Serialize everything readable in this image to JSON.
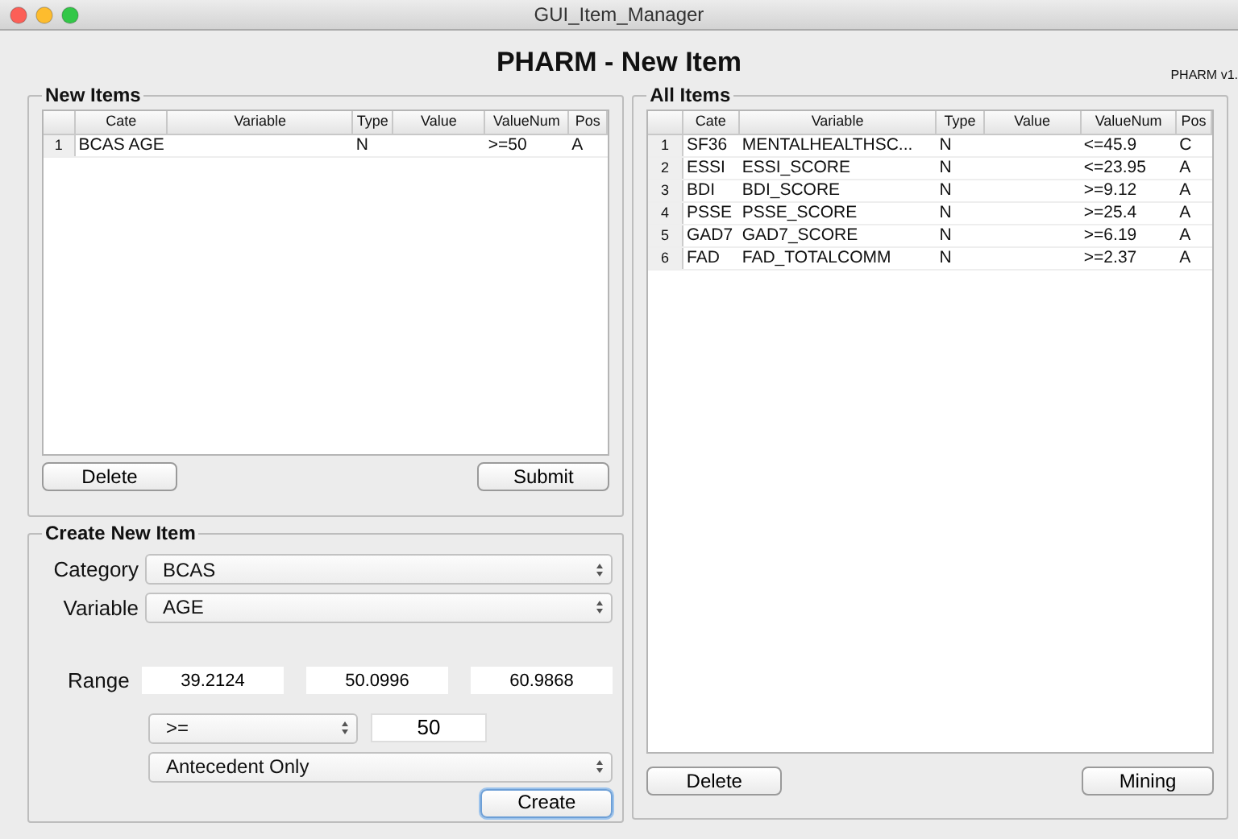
{
  "window": {
    "title": "GUI_Item_Manager"
  },
  "header": {
    "title": "PHARM - New Item",
    "version": "PHARM v1."
  },
  "new_items": {
    "title": "New Items",
    "table": {
      "columns": [
        "Cate",
        "Variable",
        "Type",
        "Value",
        "ValueNum",
        "Pos"
      ],
      "rows": [
        {
          "index": "1",
          "cells": [
            "BCAS AGE",
            "",
            "N",
            "",
            ">=50",
            "A"
          ]
        }
      ]
    },
    "buttons": [
      "Delete",
      "Submit"
    ]
  },
  "create_new_item": {
    "title": "Create New Item",
    "category": {
      "label": "Category",
      "value": "BCAS"
    },
    "variable": {
      "label": "Variable",
      "value": "AGE"
    },
    "range": {
      "label": "Range",
      "values": [
        "39.2124",
        "50.0996",
        "60.9868"
      ]
    },
    "operator": {
      "value": ">="
    },
    "threshold": {
      "value": "50"
    },
    "position": {
      "value": "Antecedent Only"
    },
    "button": "Create"
  },
  "all_items": {
    "title": "All Items",
    "table": {
      "columns": [
        "Cate",
        "Variable",
        "Type",
        "Value",
        "ValueNum",
        "Pos"
      ],
      "rows": [
        {
          "index": "1",
          "cells": [
            "SF36",
            "MENTALHEALTHSC...",
            "N",
            "",
            "<=45.9",
            "C"
          ]
        },
        {
          "index": "2",
          "cells": [
            "ESSI",
            "ESSI_SCORE",
            "N",
            "",
            "<=23.95",
            "A"
          ]
        },
        {
          "index": "3",
          "cells": [
            "BDI",
            "BDI_SCORE",
            "N",
            "",
            ">=9.12",
            "A"
          ]
        },
        {
          "index": "4",
          "cells": [
            "PSSE",
            "PSSE_SCORE",
            "N",
            "",
            ">=25.4",
            "A"
          ]
        },
        {
          "index": "5",
          "cells": [
            "GAD7",
            "GAD7_SCORE",
            "N",
            "",
            ">=6.19",
            "A"
          ]
        },
        {
          "index": "6",
          "cells": [
            "FAD",
            "FAD_TOTALCOMM",
            "N",
            "",
            ">=2.37",
            "A"
          ]
        }
      ]
    },
    "buttons": [
      "Delete",
      "Mining"
    ]
  }
}
